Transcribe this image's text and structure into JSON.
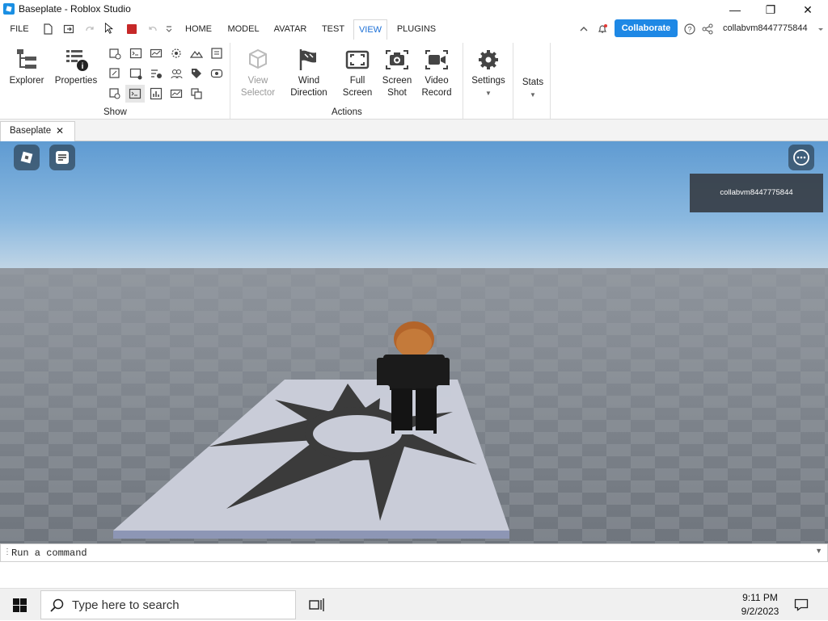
{
  "window": {
    "title": "Baseplate - Roblox Studio",
    "minimize": "—",
    "restore": "❐",
    "close": "✕"
  },
  "menu": {
    "file": "FILE",
    "tabs": [
      "HOME",
      "MODEL",
      "AVATAR",
      "TEST",
      "VIEW",
      "PLUGINS"
    ],
    "active_tab": "VIEW",
    "collaborate": "Collaborate",
    "username": "collabvm8447775844"
  },
  "ribbon": {
    "show": {
      "explorer": "Explorer",
      "properties": "Properties",
      "label": "Show"
    },
    "actions": {
      "view_selector": [
        "View",
        "Selector"
      ],
      "wind_direction": [
        "Wind",
        "Direction"
      ],
      "full_screen": [
        "Full",
        "Screen"
      ],
      "screen_shot": [
        "Screen",
        "Shot"
      ],
      "video_record": [
        "Video",
        "Record"
      ],
      "label": "Actions"
    },
    "settings": "Settings",
    "stats": "Stats"
  },
  "document_tab": {
    "label": "Baseplate",
    "close": "✕"
  },
  "viewport": {
    "player_card": "collabvm8447775844"
  },
  "command_bar": {
    "placeholder": "Run a command"
  },
  "taskbar": {
    "search_placeholder": "Type here to search",
    "time": "9:11 PM",
    "date": "9/2/2023"
  },
  "colors": {
    "accent": "#1e88e5",
    "active_tab_text": "#1b6fd6",
    "record_stop": "#c62828"
  }
}
